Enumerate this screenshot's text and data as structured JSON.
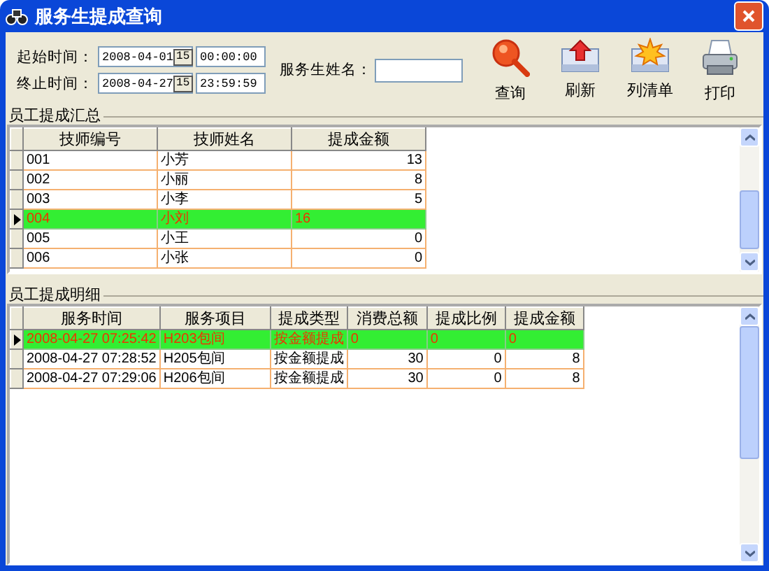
{
  "window": {
    "title": "服务生提成查询"
  },
  "filters": [
    {
      "label": "起始时间：",
      "date": "2008-04-01",
      "picker": "15",
      "time": "00:00:00"
    },
    {
      "label": "终止时间：",
      "date": "2008-04-27",
      "picker": "15",
      "time": "23:59:59"
    }
  ],
  "waiter": {
    "label": "服务生姓名："
  },
  "toolbar": [
    {
      "label": "查询",
      "kind": "search"
    },
    {
      "label": "刷新",
      "kind": "refresh"
    },
    {
      "label": "列清单",
      "kind": "list"
    },
    {
      "label": "打印",
      "kind": "print"
    }
  ],
  "summary": {
    "title": "员工提成汇总",
    "columns": [
      {
        "label": "技师编号",
        "kind": "text"
      },
      {
        "label": "技师姓名",
        "kind": "text"
      },
      {
        "label": "提成金额",
        "kind": "number"
      }
    ],
    "rows": [
      {
        "cells": [
          "001",
          "小芳",
          "13"
        ],
        "selected": false
      },
      {
        "cells": [
          "002",
          "小丽",
          "8"
        ],
        "selected": false
      },
      {
        "cells": [
          "003",
          "小李",
          "5"
        ],
        "selected": false
      },
      {
        "cells": [
          "004",
          "小刘",
          "16"
        ],
        "selected": true
      },
      {
        "cells": [
          "005",
          "小王",
          "0"
        ],
        "selected": false
      },
      {
        "cells": [
          "006",
          "小张",
          "0"
        ],
        "selected": false
      }
    ]
  },
  "details": {
    "title": "员工提成明细",
    "columns": [
      {
        "label": "服务时间",
        "kind": "text"
      },
      {
        "label": "服务项目",
        "kind": "text"
      },
      {
        "label": "提成类型",
        "kind": "text"
      },
      {
        "label": "消费总额",
        "kind": "number"
      },
      {
        "label": "提成比例",
        "kind": "number"
      },
      {
        "label": "提成金额",
        "kind": "number"
      }
    ],
    "rows": [
      {
        "cells": [
          "2008-04-27 07:25:42",
          "H203包间",
          "按金额提成",
          "0",
          "0",
          "0"
        ],
        "selected": true
      },
      {
        "cells": [
          "2008-04-27 07:28:52",
          "H205包间",
          "按金额提成",
          "30",
          "0",
          "8"
        ],
        "selected": false
      },
      {
        "cells": [
          "2008-04-27 07:29:06",
          "H206包间",
          "按金额提成",
          "30",
          "0",
          "8"
        ],
        "selected": false
      }
    ]
  }
}
